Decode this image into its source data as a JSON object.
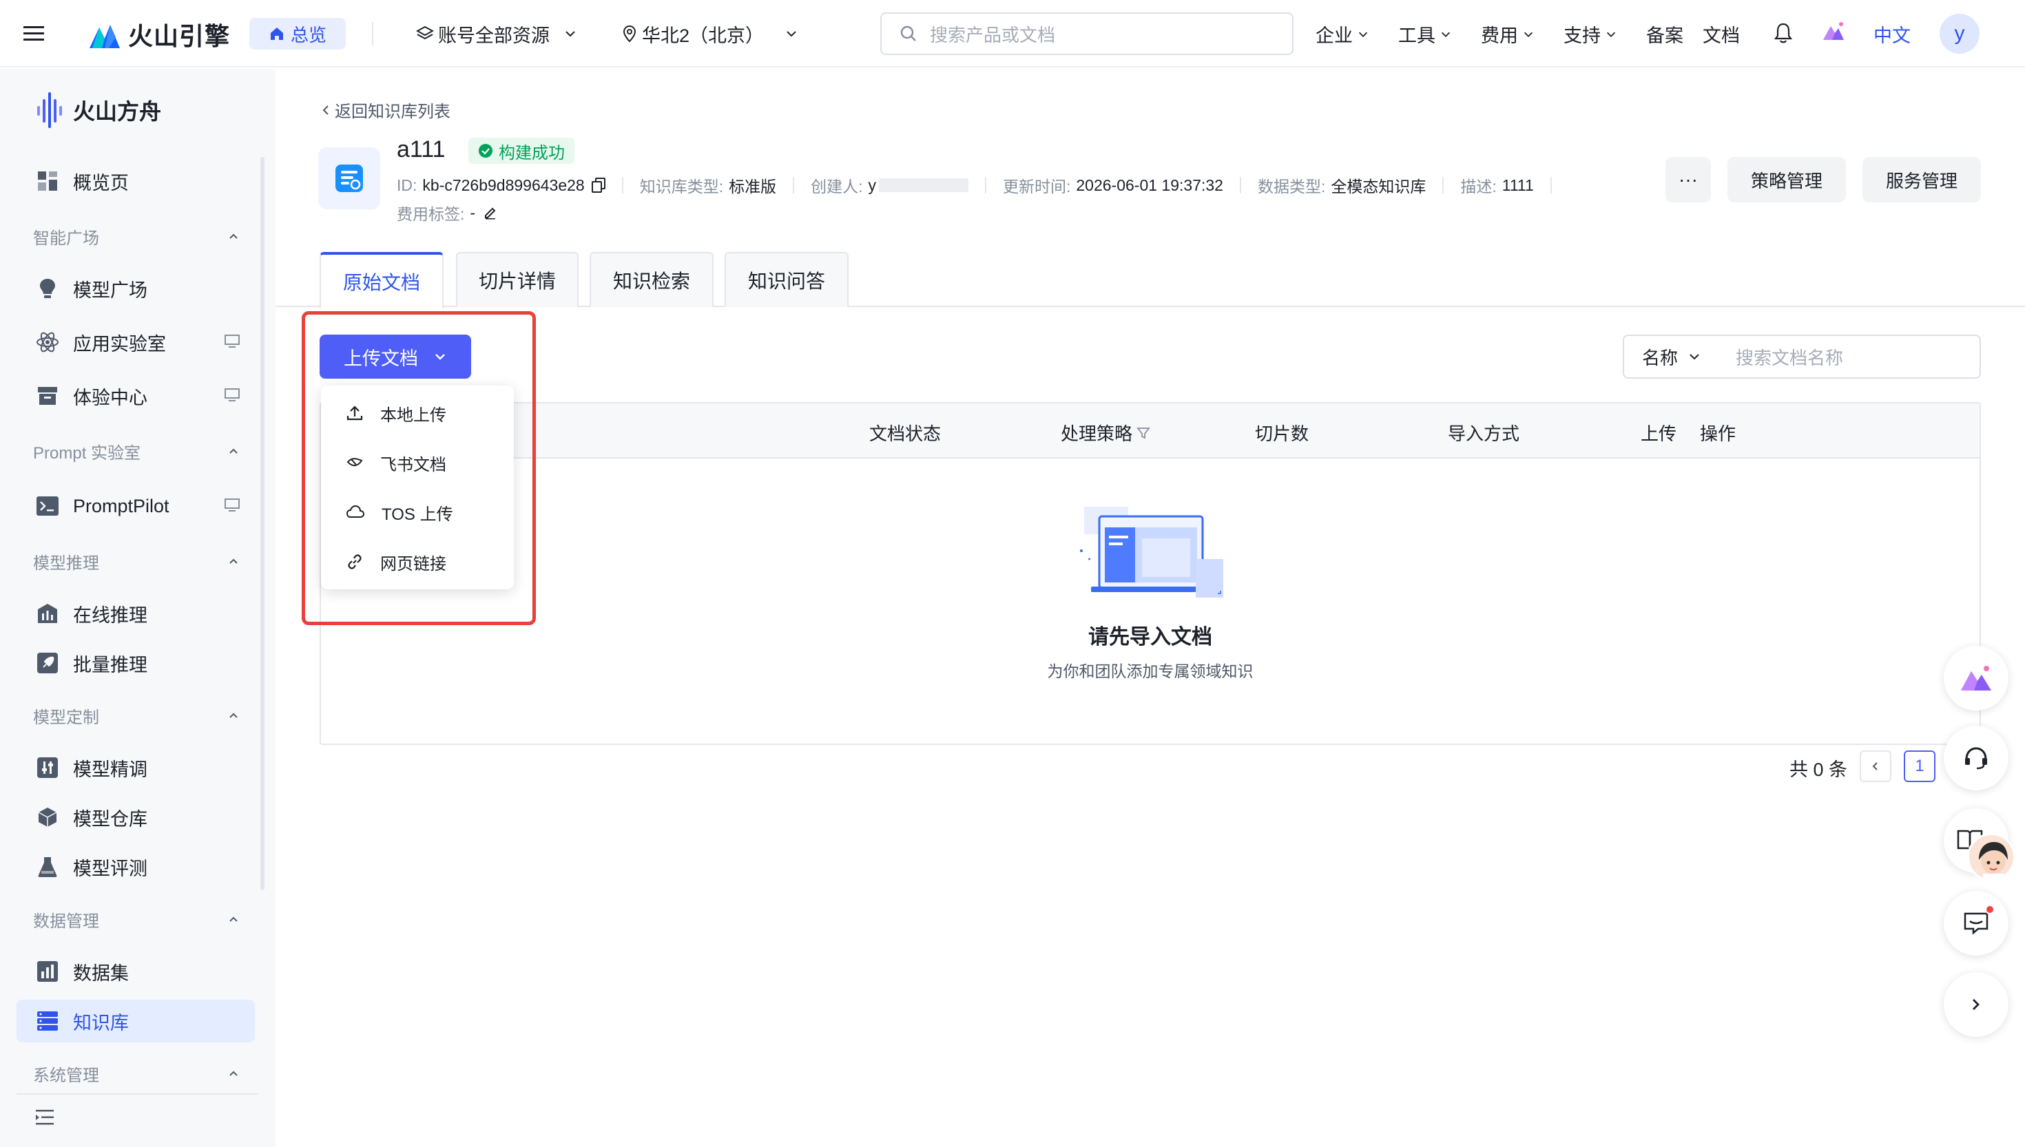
{
  "topbar": {
    "brand": "火山引擎",
    "home": "总览",
    "account_scope": "账号全部资源",
    "region": "华北2（北京）",
    "search_placeholder": "搜索产品或文档",
    "nav": [
      "企业",
      "工具",
      "费用",
      "支持",
      "备案",
      "文档"
    ],
    "language": "中文",
    "avatar_initial": "y"
  },
  "sidebar": {
    "brand": "火山方舟",
    "overview": "概览页",
    "groups": {
      "smart_square": "智能广场",
      "prompt_lab": "Prompt 实验室",
      "inference": "模型推理",
      "customization": "模型定制",
      "data": "数据管理",
      "system": "系统管理"
    },
    "items": {
      "model_square": "模型广场",
      "app_lab": "应用实验室",
      "experience": "体验中心",
      "prompt_pilot": "PromptPilot",
      "online_inference": "在线推理",
      "batch_inference": "批量推理",
      "fine_tune": "模型精调",
      "model_repo": "模型仓库",
      "model_eval": "模型评测",
      "dataset": "数据集",
      "knowledge_base": "知识库"
    }
  },
  "header": {
    "back": "返回知识库列表",
    "name": "a111",
    "status": "构建成功",
    "id_label": "ID:",
    "id_value": "kb-c726b9d899643e28",
    "type_label": "知识库类型:",
    "type_value": "标准版",
    "creator_label": "创建人:",
    "creator_value": "y",
    "updated_label": "更新时间:",
    "updated_value": "2026-06-01 19:37:32",
    "data_type_label": "数据类型:",
    "data_type_value": "全模态知识库",
    "desc_label": "描述:",
    "desc_value": "1111",
    "cost_tag_label": "费用标签:",
    "cost_tag_value": "-",
    "more": "···",
    "strategy_btn": "策略管理",
    "service_btn": "服务管理"
  },
  "tabs": [
    "原始文档",
    "切片详情",
    "知识检索",
    "知识问答"
  ],
  "toolbar": {
    "upload": "上传文档",
    "filter_field": "名称",
    "filter_placeholder": "搜索文档名称"
  },
  "dropdown": {
    "items": [
      "本地上传",
      "飞书文档",
      "TOS 上传",
      "网页链接"
    ]
  },
  "table": {
    "columns": [
      "文档状态",
      "处理策略",
      "切片数",
      "导入方式",
      "上传",
      "操作"
    ],
    "empty_title": "请先导入文档",
    "empty_subtitle": "为你和团队添加专属领域知识"
  },
  "pagination": {
    "total": "共 0 条",
    "current": "1"
  },
  "colors": {
    "primary": "#4f5ef7",
    "link": "#2f54eb",
    "success": "#00a35a",
    "highlight": "#e8413c"
  }
}
